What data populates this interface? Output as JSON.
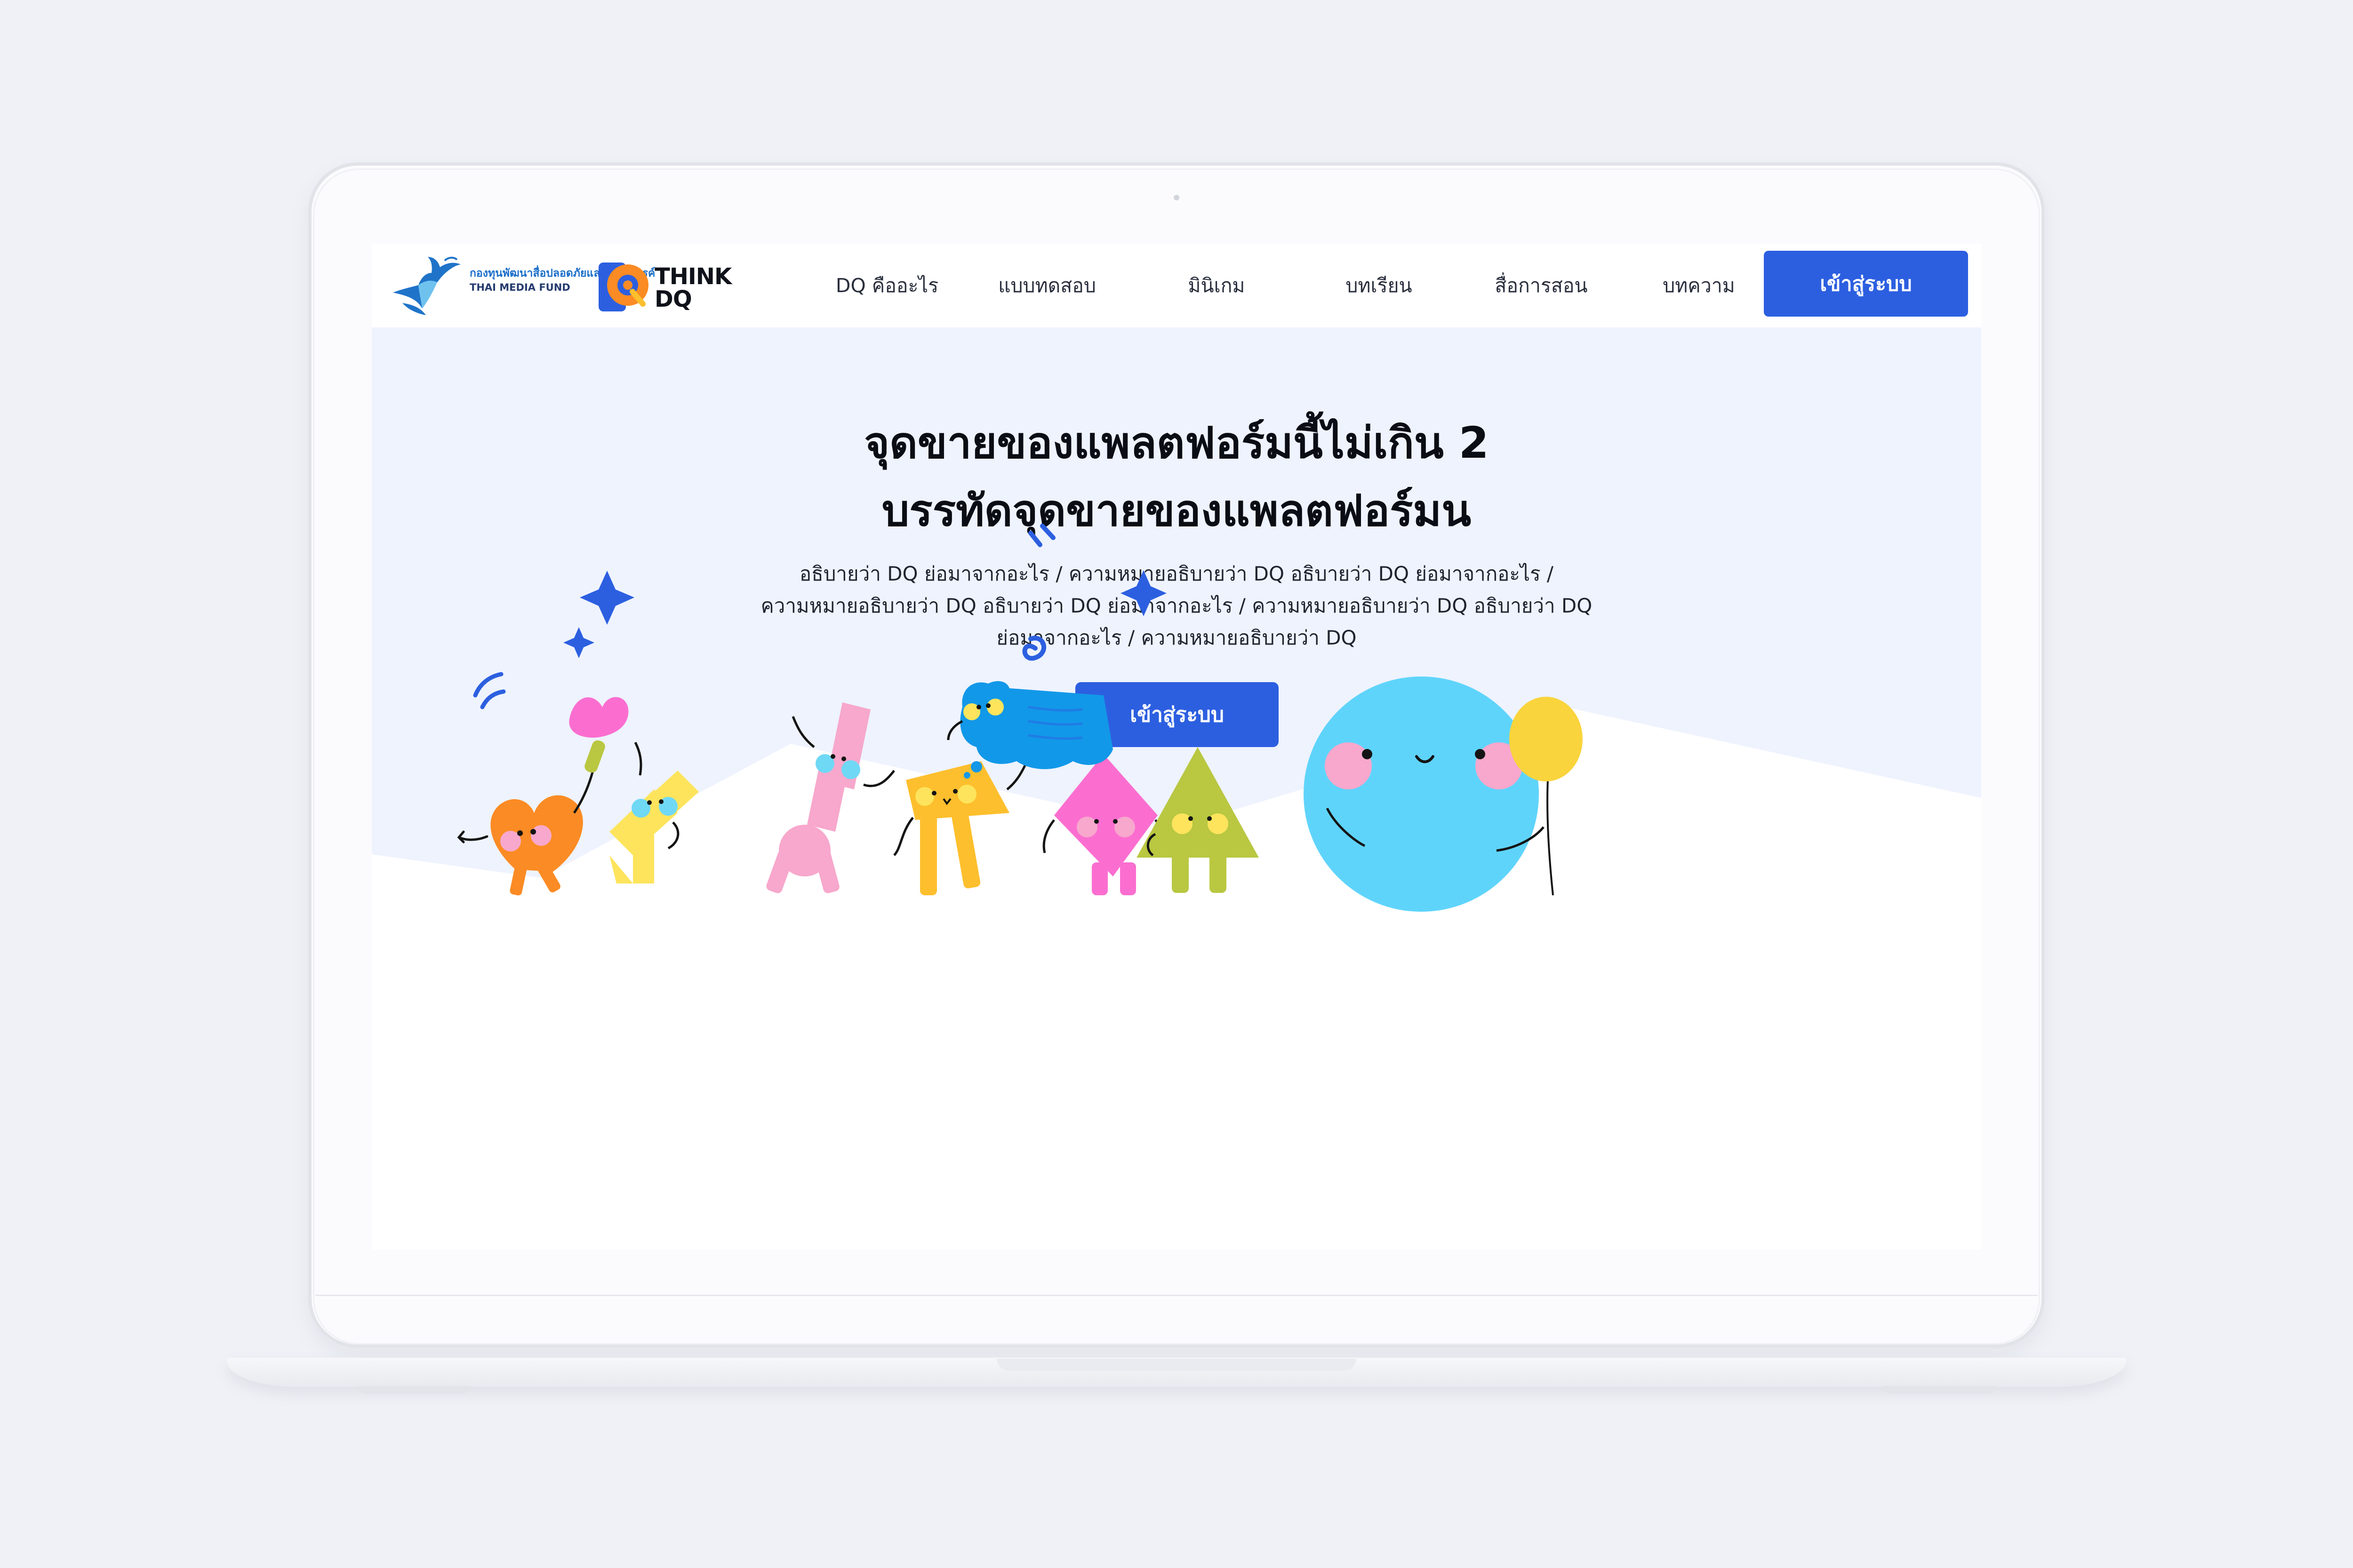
{
  "brand": {
    "fund_name_th": "กองทุนพัฒนาสื่อปลอดภัยและสร้างสรรค์",
    "fund_name_en": "THAI MEDIA FUND",
    "product_name": "THINK DQ",
    "product_line1": "THINK",
    "product_line2": "DQ"
  },
  "nav": {
    "items": [
      {
        "label": "DQ คืออะไร"
      },
      {
        "label": "แบบทดสอบ"
      },
      {
        "label": "มินิเกม"
      },
      {
        "label": "บทเรียน"
      },
      {
        "label": "สื่อการสอน"
      },
      {
        "label": "บทความ"
      }
    ],
    "login_label": "เข้าสู่ระบบ"
  },
  "hero": {
    "headline_line1": "จุดขายของแพลตฟอร์มนี้ไม่เกิน 2",
    "headline_line2": "บรรทัดจุดขายของแพลตฟอร์มน",
    "subtext_line1": "อธิบายว่า DQ ย่อมาจากอะไร / ความหมายอธิบายว่า DQ อธิบายว่า DQ ย่อมาจากอะไร /",
    "subtext_line2": "ความหมายอธิบายว่า DQ อธิบายว่า DQ ย่อมาจากอะไร / ความหมายอธิบายว่า DQ อธิบายว่า DQ",
    "subtext_line3": "ย่อมาจากอะไร / ความหมายอธิบายว่า DQ",
    "cta_label": "เข้าสู่ระบบ"
  },
  "colors": {
    "primary": "#2c5fe0",
    "hero_background": "#eef3fe",
    "page_background": "#eff1f6",
    "character_orange": "#fb8b24",
    "character_yellow": "#fde45c",
    "character_pink_light": "#f7a8cc",
    "character_amber": "#fdbf2d",
    "character_magenta": "#fb6ed0",
    "character_blue": "#1298e8",
    "character_olive": "#b9c741",
    "character_cyan": "#5fd4fb",
    "balloon": "#f9d43c",
    "sparkle": "#2c5fe0"
  },
  "illustration": {
    "characters": [
      "heart-character",
      "l-shape-character",
      "stacked-character",
      "arrow-character",
      "diamond-character",
      "cloud-character",
      "triangle-character",
      "circle-character"
    ],
    "decorations": [
      "sparkle-icon",
      "flower-icon",
      "balloon-icon"
    ]
  }
}
